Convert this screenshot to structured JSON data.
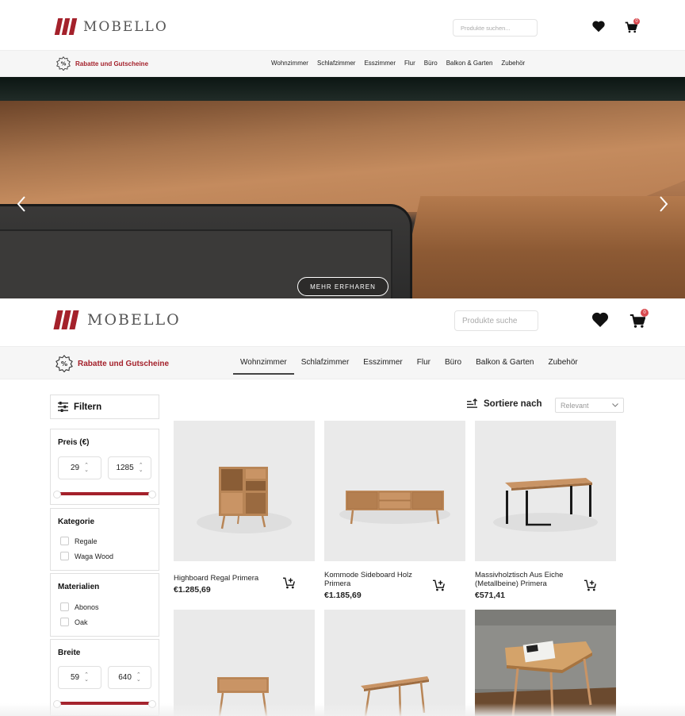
{
  "brand": {
    "name": "MOBELLO",
    "accent": "#a4212b"
  },
  "header_top": {
    "search_placeholder": "Produkte suchen...",
    "cart_count": "0"
  },
  "promo": {
    "label": "Rabatte und Gutscheine"
  },
  "nav": [
    "Wohnzimmer",
    "Schlafzimmer",
    "Esszimmer",
    "Flur",
    "Büro",
    "Balkon & Garten",
    "Zubehör"
  ],
  "hero": {
    "cta": "MEHR ERFHAREN",
    "prev_icon": "chevron-left-icon",
    "next_icon": "chevron-right-icon"
  },
  "header_main": {
    "search_placeholder": "Produkte suche",
    "cart_count": "0",
    "active_nav": "Wohnzimmer"
  },
  "filters": {
    "title": "Filtern",
    "price": {
      "label": "Preis (€)",
      "min": "29",
      "max": "1285"
    },
    "category": {
      "label": "Kategorie",
      "options": [
        "Regale",
        "Waga Wood"
      ]
    },
    "materials": {
      "label": "Materialien",
      "options": [
        "Abonos",
        "Oak"
      ]
    },
    "width": {
      "label": "Breite",
      "min": "59",
      "max": "640"
    }
  },
  "sort": {
    "label": "Sortiere nach",
    "value": "Relevant"
  },
  "products": [
    {
      "name": "Highboard Regal Primera",
      "price": "€1.285,69"
    },
    {
      "name": "Kommode Sideboard Holz Primera",
      "price": "€1.185,69"
    },
    {
      "name": "Massivholztisch Aus Eiche (Metallbeine) Primera",
      "price": "€571,41"
    },
    {
      "name": "",
      "price": ""
    },
    {
      "name": "",
      "price": ""
    },
    {
      "name": "",
      "price": ""
    }
  ]
}
